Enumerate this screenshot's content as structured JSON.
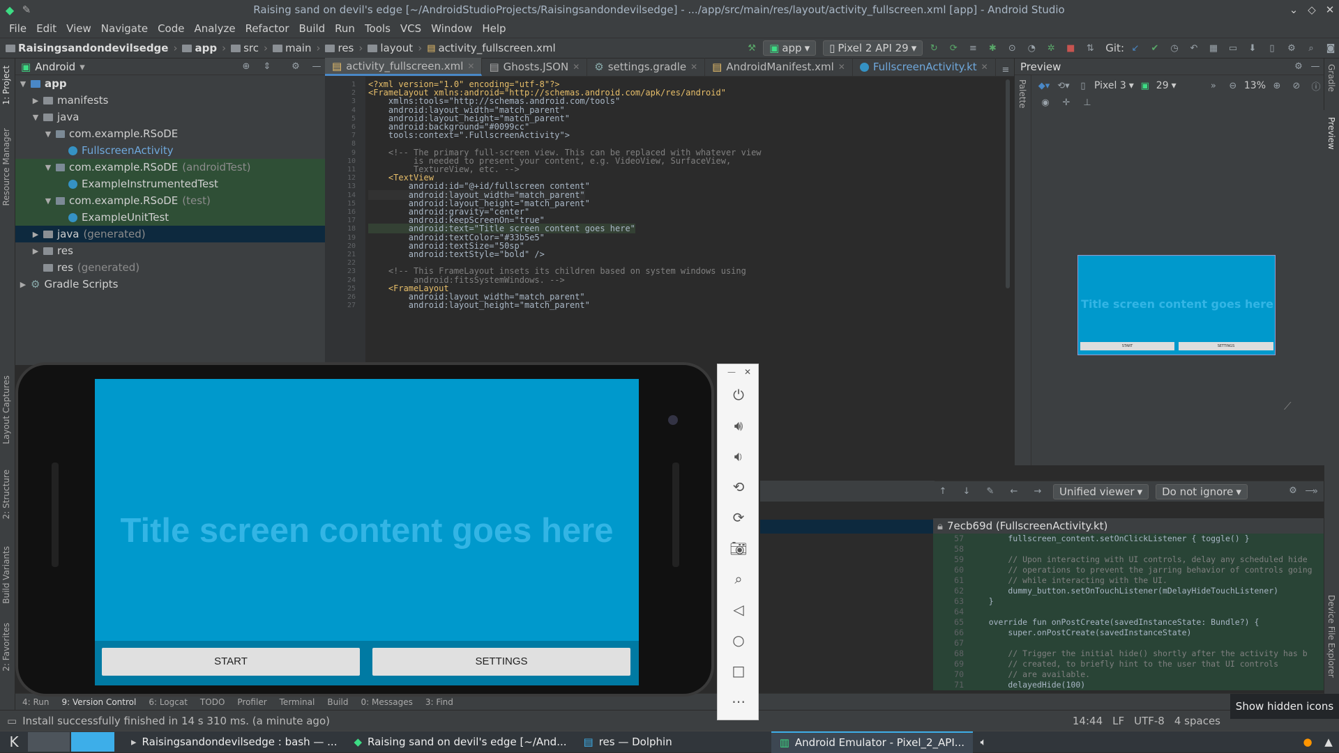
{
  "window": {
    "title": "Raising sand on devil's edge [~/AndroidStudioProjects/Raisingsandondevilsedge] - .../app/src/main/res/layout/activity_fullscreen.xml [app] - Android Studio"
  },
  "menu": [
    "File",
    "Edit",
    "View",
    "Navigate",
    "Code",
    "Analyze",
    "Refactor",
    "Build",
    "Run",
    "Tools",
    "VCS",
    "Window",
    "Help"
  ],
  "breadcrumb": [
    "Raisingsandondevilsedge",
    "app",
    "src",
    "main",
    "res",
    "layout",
    "activity_fullscreen.xml"
  ],
  "toolbar": {
    "config": "app",
    "device": "Pixel 2 API 29",
    "git": "Git:"
  },
  "project": {
    "view": "Android",
    "tree": [
      {
        "label": "app",
        "suffix": ""
      },
      {
        "label": "manifests",
        "suffix": ""
      },
      {
        "label": "java",
        "suffix": ""
      },
      {
        "label": "com.example.RSoDE",
        "suffix": ""
      },
      {
        "label": "FullscreenActivity",
        "suffix": ""
      },
      {
        "label": "com.example.RSoDE",
        "suffix": "(androidTest)"
      },
      {
        "label": "ExampleInstrumentedTest",
        "suffix": ""
      },
      {
        "label": "com.example.RSoDE",
        "suffix": "(test)"
      },
      {
        "label": "ExampleUnitTest",
        "suffix": ""
      },
      {
        "label": "java",
        "suffix": "(generated)"
      },
      {
        "label": "res",
        "suffix": ""
      },
      {
        "label": "res",
        "suffix": "(generated)"
      },
      {
        "label": "Gradle Scripts",
        "suffix": ""
      }
    ]
  },
  "tabs": [
    "activity_fullscreen.xml",
    "Ghosts.JSON",
    "settings.gradle",
    "AndroidManifest.xml",
    "FullscreenActivity.kt"
  ],
  "code": {
    "lines": [
      {
        "n": "1",
        "t": "<?xml version=\"1.0\" encoding=\"utf-8\"?>"
      },
      {
        "n": "2",
        "t": "<FrameLayout xmlns:android=\"http://schemas.android.com/apk/res/android\""
      },
      {
        "n": "3",
        "t": "    xmlns:tools=\"http://schemas.android.com/tools\""
      },
      {
        "n": "4",
        "t": "    android:layout_width=\"match_parent\""
      },
      {
        "n": "5",
        "t": "    android:layout_height=\"match_parent\""
      },
      {
        "n": "6",
        "t": "    android:background=\"#0099cc\""
      },
      {
        "n": "7",
        "t": "    tools:context=\".FullscreenActivity\">"
      },
      {
        "n": "8",
        "t": ""
      },
      {
        "n": "9",
        "t": "    <!-- The primary full-screen view. This can be replaced with whatever view"
      },
      {
        "n": "10",
        "t": "         is needed to present your content, e.g. VideoView, SurfaceView,"
      },
      {
        "n": "11",
        "t": "         TextureView, etc. -->"
      },
      {
        "n": "12",
        "t": "    <TextView"
      },
      {
        "n": "13",
        "t": "        android:id=\"@+id/fullscreen_content\""
      },
      {
        "n": "14",
        "t": "        android:layout_width=\"match_parent\""
      },
      {
        "n": "15",
        "t": "        android:layout_height=\"match_parent\""
      },
      {
        "n": "16",
        "t": "        android:gravity=\"center\""
      },
      {
        "n": "17",
        "t": "        android:keepScreenOn=\"true\""
      },
      {
        "n": "18",
        "t": "        android:text=\"Title screen content goes here\""
      },
      {
        "n": "19",
        "t": "        android:textColor=\"#33b5e5\""
      },
      {
        "n": "20",
        "t": "        android:textSize=\"50sp\""
      },
      {
        "n": "21",
        "t": "        android:textStyle=\"bold\" />"
      },
      {
        "n": "22",
        "t": ""
      },
      {
        "n": "23",
        "t": "    <!-- This FrameLayout insets its children based on system windows using"
      },
      {
        "n": "24",
        "t": "         android:fitsSystemWindows. -->"
      },
      {
        "n": "25",
        "t": "    <FrameLayout"
      },
      {
        "n": "26",
        "t": "        android:layout_width=\"match_parent\""
      },
      {
        "n": "27",
        "t": "        android:layout_height=\"match_parent\""
      }
    ]
  },
  "preview": {
    "title": "Preview",
    "device": "Pixel 3",
    "api": "29",
    "zoom": "13%",
    "mock_text": "Title screen content goes here",
    "mock_btn1": "START",
    "mock_btn2": "SETTINGS"
  },
  "vcs": {
    "viewer": "Unified viewer",
    "ignore": "Do not ignore",
    "commit": "7ecb69d (FullscreenActivity.kt)",
    "diff": [
      {
        "n": "57",
        "t": "        fullscreen_content.setOnClickListener { toggle() }",
        "add": true
      },
      {
        "n": "58",
        "t": "",
        "add": true
      },
      {
        "n": "59",
        "t": "        // Upon interacting with UI controls, delay any scheduled hide",
        "add": true
      },
      {
        "n": "60",
        "t": "        // operations to prevent the jarring behavior of controls going",
        "add": true
      },
      {
        "n": "61",
        "t": "        // while interacting with the UI.",
        "add": true
      },
      {
        "n": "62",
        "t": "        dummy_button.setOnTouchListener(mDelayHideTouchListener)",
        "add": true
      },
      {
        "n": "63",
        "t": "    }",
        "add": true
      },
      {
        "n": "64",
        "t": "",
        "add": true
      },
      {
        "n": "65",
        "t": "    override fun onPostCreate(savedInstanceState: Bundle?) {",
        "add": true
      },
      {
        "n": "66",
        "t": "        super.onPostCreate(savedInstanceState)",
        "add": true
      },
      {
        "n": "67",
        "t": "",
        "add": true
      },
      {
        "n": "68",
        "t": "        // Trigger the initial hide() shortly after the activity has b",
        "add": true
      },
      {
        "n": "69",
        "t": "        // created, to briefly hint to the user that UI controls",
        "add": true
      },
      {
        "n": "70",
        "t": "        // are available.",
        "add": true
      },
      {
        "n": "71",
        "t": "        delayedHide(100)",
        "add": true
      }
    ]
  },
  "bottom_tabs": [
    "4: Run",
    "9: Version Control",
    "6: Logcat",
    "TODO",
    "Profiler",
    "Terminal",
    "Build",
    "0: Messages",
    "3: Find"
  ],
  "status": {
    "message": "Install successfully finished in 14 s 310 ms. (a minute ago)",
    "position": "14:44",
    "line_sep": "LF",
    "encoding": "UTF-8",
    "indent": "4 spaces"
  },
  "emulator": {
    "title_text": "Title screen content goes here",
    "start": "START",
    "settings": "SETTINGS"
  },
  "side_tabs_left": [
    "1: Project",
    "Resource Manager",
    "Layout Captures",
    "2: Structure",
    "Build Variants",
    "2: Favorites"
  ],
  "side_tabs_right": [
    "Gradle",
    "Preview",
    "Device File Explorer"
  ],
  "taskbar": {
    "items": [
      "Raisingsandondevilsedge : bash — ...",
      "Raising sand on devil's edge [~/And...",
      "res — Dolphin",
      "Android Emulator - Pixel_2_API..."
    ],
    "hidden_icons": "Show hidden icons"
  },
  "colors": {
    "accent": "#4a88c7",
    "screen": "#0099cc",
    "title_text": "#33b5e5"
  }
}
